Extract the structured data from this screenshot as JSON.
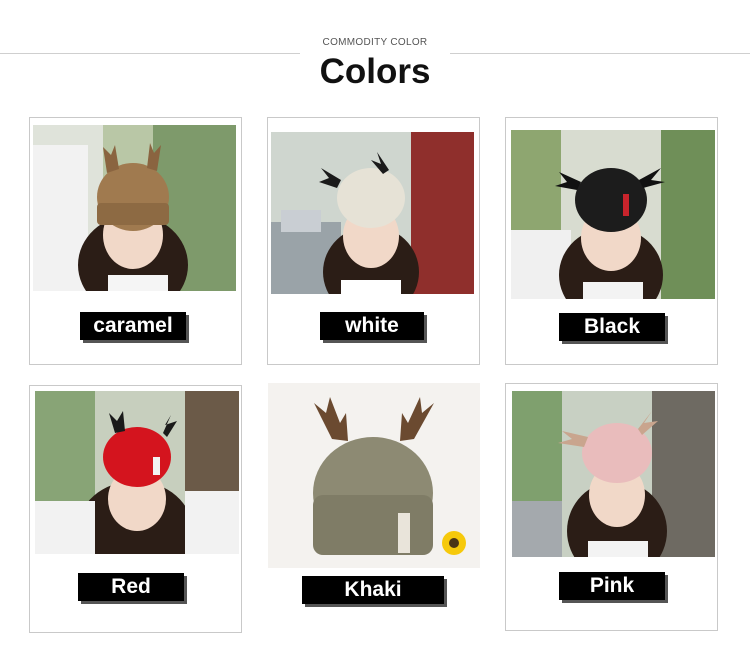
{
  "header": {
    "subtitle": "COMMODITY COLOR",
    "title": "Colors"
  },
  "products": [
    {
      "label": "caramel",
      "hat_color": "#a07a4f",
      "antler_color": "#8a6440"
    },
    {
      "label": "white",
      "hat_color": "#e6e2d6",
      "antler_color": "#1a1a1a"
    },
    {
      "label": "Black",
      "hat_color": "#1c1c1c",
      "antler_color": "#111111"
    },
    {
      "label": "Red",
      "hat_color": "#d4141e",
      "antler_color": "#1a1a1a"
    },
    {
      "label": "Khaki",
      "hat_color": "#8d8a73",
      "antler_color": "#6b4a30"
    },
    {
      "label": "Pink",
      "hat_color": "#e9bcbc",
      "antler_color": "#c9a58e"
    }
  ]
}
